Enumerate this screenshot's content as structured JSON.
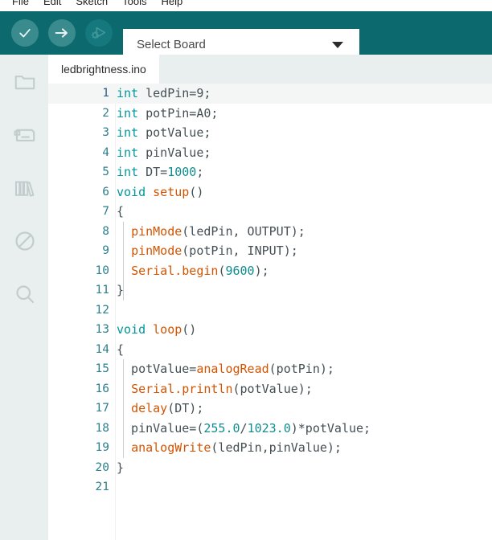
{
  "window": {
    "title": "ledbrightness.ino",
    "accent_teal": "#0c6a6e",
    "sidebar_bg": "#e9efef"
  },
  "menubar": {
    "items": [
      {
        "label": "File"
      },
      {
        "label": "Edit"
      },
      {
        "label": "Sketch"
      },
      {
        "label": "Tools"
      },
      {
        "label": "Help"
      }
    ]
  },
  "toolbar": {
    "verify_tooltip": "Verify",
    "upload_tooltip": "Upload",
    "debug_tooltip": "Debug",
    "board_select": {
      "value": "Select Board",
      "placeholder": "Select Board"
    }
  },
  "sidebar": {
    "items": [
      {
        "name": "sketchbook",
        "icon": "folder-icon"
      },
      {
        "name": "boards-manager",
        "icon": "board-icon"
      },
      {
        "name": "library-manager",
        "icon": "books-icon"
      },
      {
        "name": "debug",
        "icon": "no-entry-icon"
      },
      {
        "name": "search",
        "icon": "search-icon"
      }
    ]
  },
  "tabs": [
    {
      "label": "ledbrightness.ino",
      "active": true
    }
  ],
  "editor": {
    "lines": [
      {
        "n": "1",
        "tokens": [
          {
            "t": "int",
            "c": "kw"
          },
          {
            "t": " ledPin=9;",
            "c": "pl"
          }
        ]
      },
      {
        "n": "2",
        "tokens": [
          {
            "t": "int",
            "c": "kw"
          },
          {
            "t": " potPin=A0;",
            "c": "pl"
          }
        ]
      },
      {
        "n": "3",
        "tokens": [
          {
            "t": "int",
            "c": "kw"
          },
          {
            "t": " potValue;",
            "c": "pl"
          }
        ]
      },
      {
        "n": "4",
        "tokens": [
          {
            "t": "int",
            "c": "kw"
          },
          {
            "t": " pinValue;",
            "c": "pl"
          }
        ]
      },
      {
        "n": "5",
        "tokens": [
          {
            "t": "int",
            "c": "kw"
          },
          {
            "t": " DT=",
            "c": "pl"
          },
          {
            "t": "1000",
            "c": "num"
          },
          {
            "t": ";",
            "c": "pl"
          }
        ]
      },
      {
        "n": "6",
        "tokens": [
          {
            "t": "void",
            "c": "kw"
          },
          {
            "t": " ",
            "c": "pl"
          },
          {
            "t": "setup",
            "c": "fn"
          },
          {
            "t": "()",
            "c": "pl"
          }
        ]
      },
      {
        "n": "7",
        "tokens": [
          {
            "t": "{",
            "c": "pl"
          }
        ]
      },
      {
        "n": "8",
        "tokens": [
          {
            "t": "  ",
            "c": "pl"
          },
          {
            "t": "pinMode",
            "c": "fn"
          },
          {
            "t": "(ledPin, OUTPUT);",
            "c": "pl"
          }
        ]
      },
      {
        "n": "9",
        "tokens": [
          {
            "t": "  ",
            "c": "pl"
          },
          {
            "t": "pinMode",
            "c": "fn"
          },
          {
            "t": "(potPin, INPUT);",
            "c": "pl"
          }
        ]
      },
      {
        "n": "10",
        "tokens": [
          {
            "t": "  ",
            "c": "pl"
          },
          {
            "t": "Serial.begin",
            "c": "fn"
          },
          {
            "t": "(",
            "c": "pl"
          },
          {
            "t": "9600",
            "c": "num"
          },
          {
            "t": ");",
            "c": "pl"
          }
        ]
      },
      {
        "n": "11",
        "tokens": [
          {
            "t": "}",
            "c": "pl"
          }
        ]
      },
      {
        "n": "12",
        "tokens": []
      },
      {
        "n": "13",
        "tokens": [
          {
            "t": "void",
            "c": "kw"
          },
          {
            "t": " ",
            "c": "pl"
          },
          {
            "t": "loop",
            "c": "fn"
          },
          {
            "t": "()",
            "c": "pl"
          }
        ]
      },
      {
        "n": "14",
        "tokens": [
          {
            "t": "{",
            "c": "pl"
          }
        ]
      },
      {
        "n": "15",
        "tokens": [
          {
            "t": "  potValue=",
            "c": "pl"
          },
          {
            "t": "analogRead",
            "c": "fn"
          },
          {
            "t": "(potPin);",
            "c": "pl"
          }
        ]
      },
      {
        "n": "16",
        "tokens": [
          {
            "t": "  ",
            "c": "pl"
          },
          {
            "t": "Serial.println",
            "c": "fn"
          },
          {
            "t": "(potValue);",
            "c": "pl"
          }
        ]
      },
      {
        "n": "17",
        "tokens": [
          {
            "t": "  ",
            "c": "pl"
          },
          {
            "t": "delay",
            "c": "fn"
          },
          {
            "t": "(DT);",
            "c": "pl"
          }
        ]
      },
      {
        "n": "18",
        "tokens": [
          {
            "t": "  pinValue=(",
            "c": "pl"
          },
          {
            "t": "255.0",
            "c": "num"
          },
          {
            "t": "/",
            "c": "pl"
          },
          {
            "t": "1023.0",
            "c": "num"
          },
          {
            "t": ")*potValue;",
            "c": "pl"
          }
        ]
      },
      {
        "n": "19",
        "tokens": [
          {
            "t": "  ",
            "c": "pl"
          },
          {
            "t": "analogWrite",
            "c": "fn"
          },
          {
            "t": "(ledPin,pinValue);",
            "c": "pl"
          }
        ]
      },
      {
        "n": "20",
        "tokens": [
          {
            "t": "}",
            "c": "pl"
          }
        ]
      },
      {
        "n": "21",
        "tokens": []
      }
    ],
    "current_line": "1"
  }
}
